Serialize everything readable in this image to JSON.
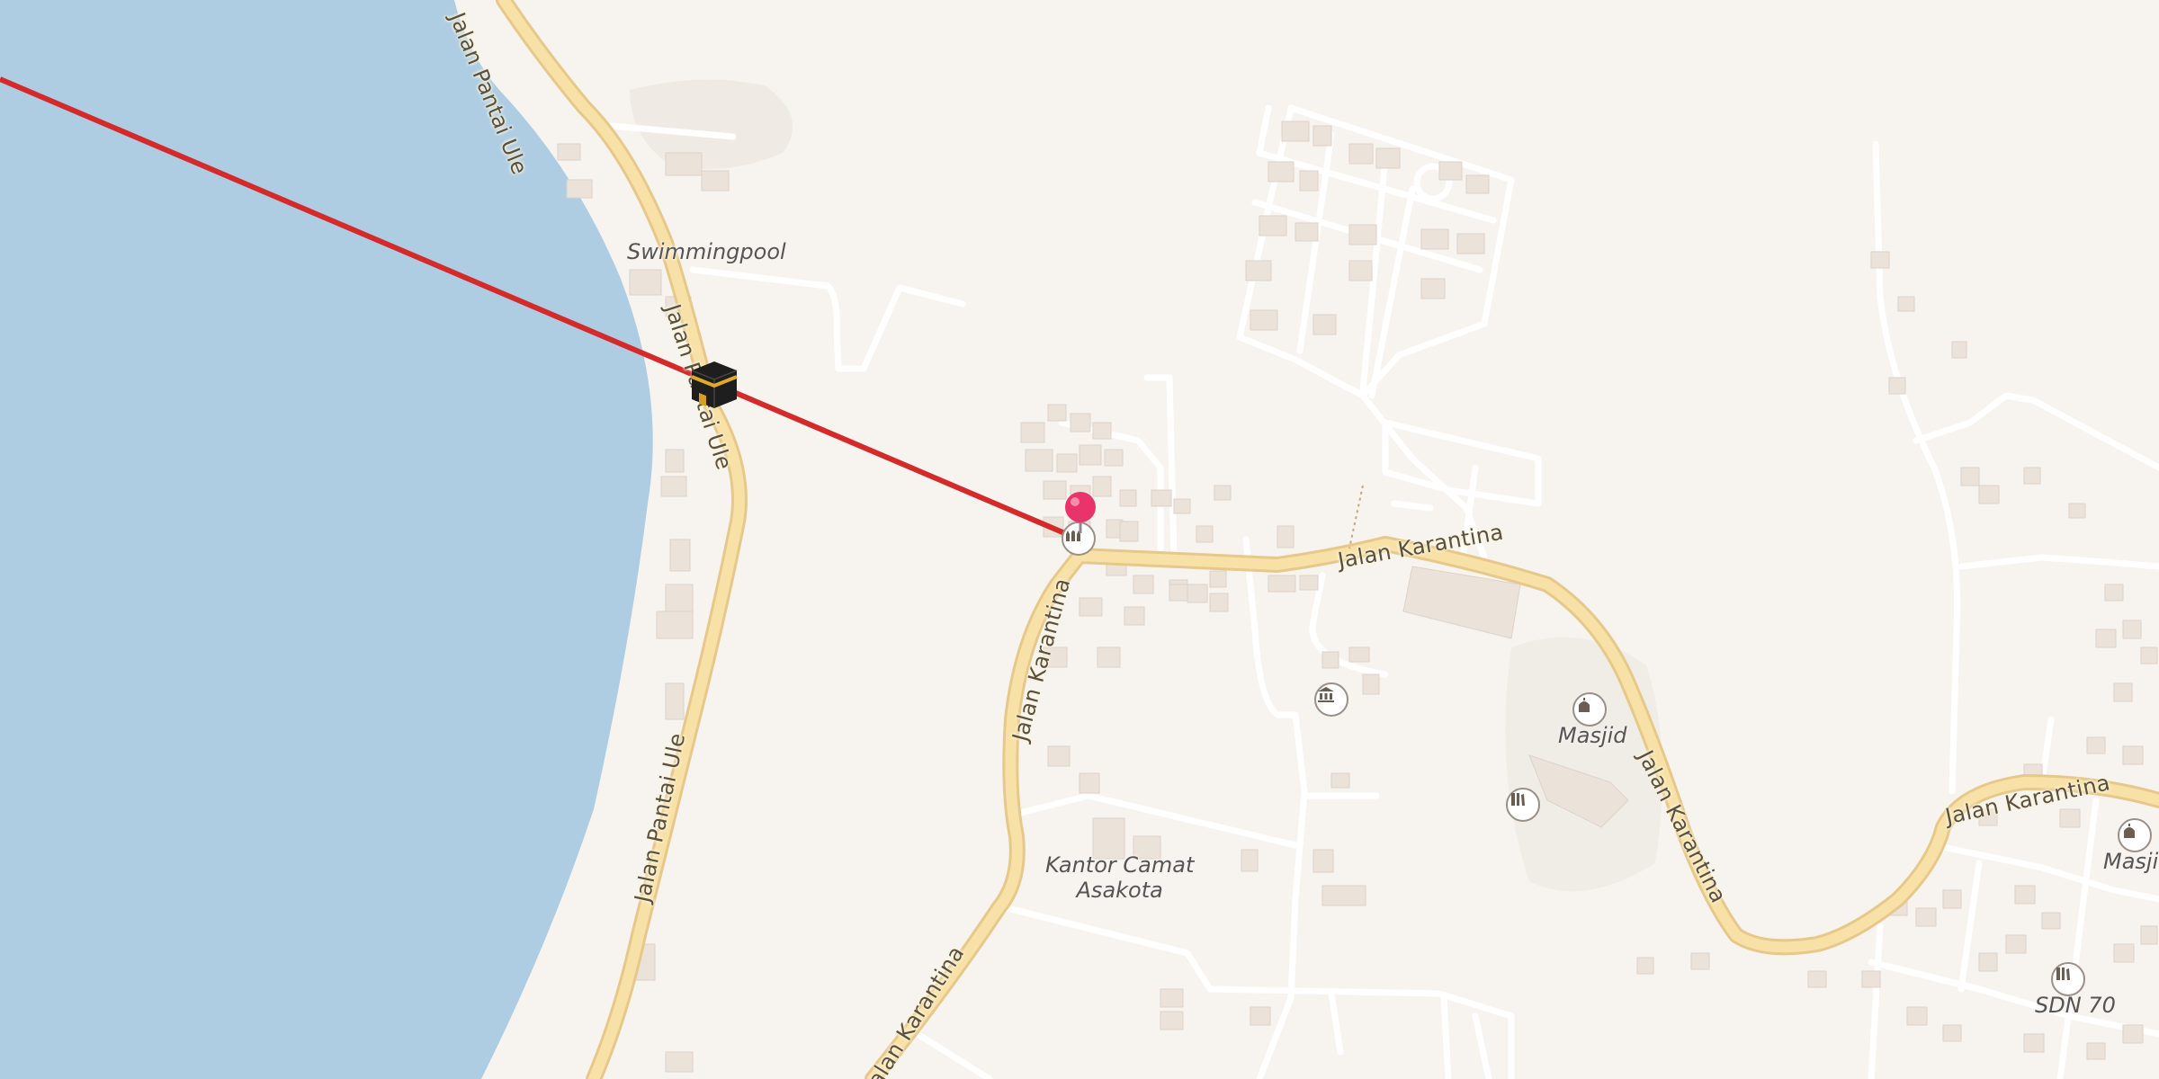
{
  "map": {
    "roads": {
      "pantai_ule_top": "Jalan Pantai Ule",
      "pantai_ule_mid": "Jalan Pantai Ule",
      "pantai_ule_bottom": "Jalan Pantai Ule",
      "karantina_1": "Jalan Karantina",
      "karantina_2": "Jalan Karantina",
      "karantina_3": "Jalan Karantina",
      "karantina_4": "Jalan Karantina",
      "karantina_5": "Jalan Karantina"
    },
    "places": {
      "swimmingpool": "Swimmingpool",
      "kantor_camat_line1": "Kantor Camat",
      "kantor_camat_line2": "Asakota",
      "masjid_1": "Masjid",
      "masjid_2": "Masjid",
      "sdn70": "SDN 70"
    },
    "icons": {
      "user_pin": "map-pin-icon",
      "kaaba": "kaaba-icon",
      "mosque": "mosque-icon",
      "museum": "museum-icon",
      "school": "school-icon"
    },
    "colors": {
      "water": "#aecde3",
      "land": "#f7f4f0",
      "major_road": "#f5dc9e",
      "qibla_line": "#d42a2a",
      "pin": "#e8336b"
    }
  }
}
